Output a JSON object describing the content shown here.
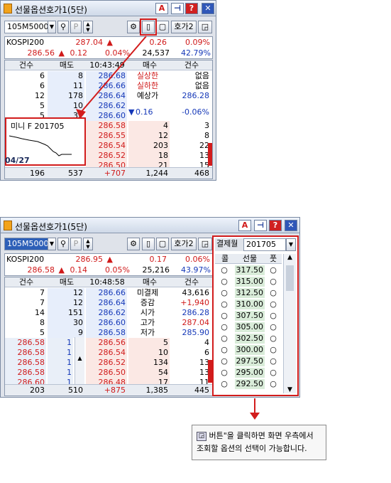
{
  "win1": {
    "title": "선물옵션호가1(5단)",
    "code": "105M5000",
    "btn_hoga2": "호가2",
    "info1": {
      "name": "KOSPI200",
      "price": "287.04",
      "arrow": "▲",
      "chg": "0.26",
      "pct": "0.09%"
    },
    "info2": {
      "price": "286.56",
      "arrow": "▲",
      "chg": "0.12",
      "pct": "0.04%",
      "vol": "24,537",
      "ratio": "42.79%"
    },
    "hdr": [
      "건수",
      "매도",
      "10:43:49",
      "매수",
      "건수"
    ],
    "asks": [
      {
        "cnt": "6",
        "qty": "8",
        "price": "286.68"
      },
      {
        "cnt": "6",
        "qty": "11",
        "price": "286.66"
      },
      {
        "cnt": "12",
        "qty": "178",
        "price": "286.64"
      },
      {
        "cnt": "5",
        "qty": "10",
        "price": "286.62"
      },
      {
        "cnt": "5",
        "qty": "32",
        "price": "286.60"
      }
    ],
    "side": [
      [
        "실상한",
        "없음"
      ],
      [
        "실하한",
        "없음"
      ],
      [
        "예상가",
        "286.28"
      ]
    ],
    "expect": {
      "arrow": "▼",
      "chg": "0.16",
      "pct": "-0.06%"
    },
    "bids": [
      {
        "price": "286.58",
        "qty": "4",
        "cnt": "3"
      },
      {
        "price": "286.55",
        "qty": "12",
        "cnt": "8"
      },
      {
        "price": "286.54",
        "qty": "203",
        "cnt": "22"
      },
      {
        "price": "286.52",
        "qty": "18",
        "cnt": "13"
      },
      {
        "price": "286.50",
        "qty": "21",
        "cnt": "15"
      }
    ],
    "mini": {
      "label": "미니 F 201705",
      "date": "04/27"
    },
    "total": [
      "196",
      "537",
      "+707",
      "1,244",
      "468"
    ]
  },
  "win2": {
    "title": "선물옵션호가1(5단)",
    "code": "105M5000",
    "btn_hoga2": "호가2",
    "info1": {
      "name": "KOSPI200",
      "price": "286.95",
      "arrow": "▲",
      "chg": "0.17",
      "pct": "0.06%"
    },
    "info2": {
      "price": "286.58",
      "arrow": "▲",
      "chg": "0.14",
      "pct": "0.05%",
      "vol": "25,216",
      "ratio": "43.97%"
    },
    "hdr": [
      "건수",
      "매도",
      "10:48:58",
      "매수",
      "건수"
    ],
    "asks": [
      {
        "cnt": "7",
        "qty": "12",
        "price": "286.66"
      },
      {
        "cnt": "7",
        "qty": "12",
        "price": "286.64"
      },
      {
        "cnt": "14",
        "qty": "151",
        "price": "286.62"
      },
      {
        "cnt": "8",
        "qty": "30",
        "price": "286.60"
      },
      {
        "cnt": "5",
        "qty": "9",
        "price": "286.58"
      }
    ],
    "side": [
      [
        "미결제",
        "43,616"
      ],
      [
        "증감",
        "+1,940"
      ],
      [
        "시가",
        "286.28"
      ],
      [
        "고가",
        "287.04"
      ],
      [
        "저가",
        "285.90"
      ]
    ],
    "bids": [
      {
        "price": "286.56",
        "qty": "5",
        "cnt": "4"
      },
      {
        "price": "286.54",
        "qty": "10",
        "cnt": "6"
      },
      {
        "price": "286.52",
        "qty": "134",
        "cnt": "13"
      },
      {
        "price": "286.50",
        "qty": "54",
        "cnt": "13"
      },
      {
        "price": "286.48",
        "qty": "17",
        "cnt": "11"
      }
    ],
    "ticks": [
      {
        "price": "286.58",
        "qty": "1"
      },
      {
        "price": "286.58",
        "qty": "1"
      },
      {
        "price": "286.58",
        "qty": "1"
      },
      {
        "price": "286.58",
        "qty": "1"
      },
      {
        "price": "286.60",
        "qty": "1"
      }
    ],
    "total": [
      "203",
      "510",
      "+875",
      "1,385",
      "445"
    ],
    "opt": {
      "month_label": "결제월",
      "month": "201705",
      "hdr": [
        "콜",
        "선물",
        "풋"
      ],
      "strikes": [
        "317.50",
        "315.00",
        "312.50",
        "310.00",
        "307.50",
        "305.00",
        "302.50",
        "300.00",
        "297.50",
        "295.00",
        "292.50"
      ]
    }
  },
  "note": {
    "line1": "버튼\"을 클릭하면 화면 우측에서",
    "line2": "조회할 옵션의 선택이 가능합니다."
  }
}
